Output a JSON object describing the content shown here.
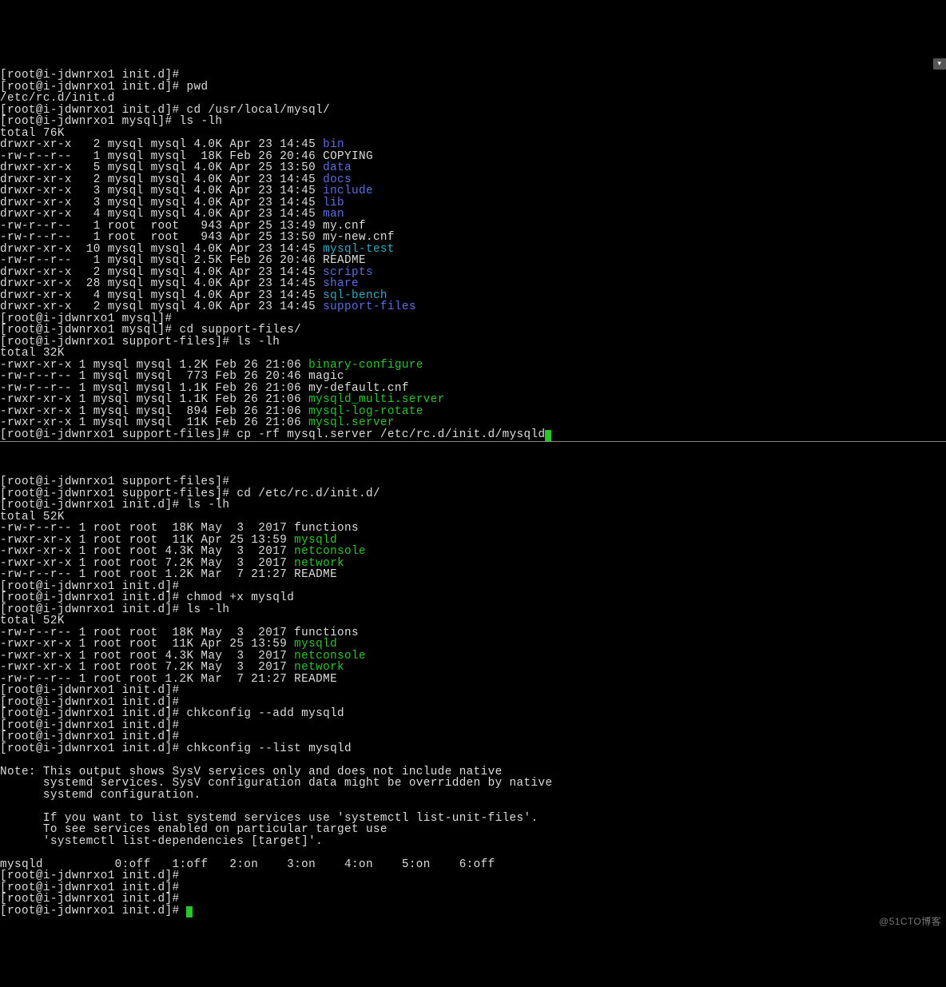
{
  "prompts": {
    "initd": "[root@i-jdwnrxo1 init.d]#",
    "mysql": "[root@i-jdwnrxo1 mysql]#",
    "support": "[root@i-jdwnrxo1 support-files]#"
  },
  "pane1": {
    "cmds": {
      "pwd": "pwd",
      "pwd_out": "/etc/rc.d/init.d",
      "cd_mysql": "cd /usr/local/mysql/",
      "ls": "ls -lh",
      "cd_support": "cd support-files/",
      "cp": "cp -rf mysql.server /etc/rc.d/init.d/mysqld"
    },
    "ls_mysql": {
      "total": "total 76K",
      "rows": [
        {
          "perm": "drwxr-xr-x",
          "ln": "  2",
          "u": "mysql",
          "g": "mysql",
          "sz": "4.0K",
          "dt": "Apr 23 14:45",
          "name": "bin",
          "cls": "b"
        },
        {
          "perm": "-rw-r--r--",
          "ln": "  1",
          "u": "mysql",
          "g": "mysql",
          "sz": " 18K",
          "dt": "Feb 26 20:46",
          "name": "COPYING",
          "cls": "w"
        },
        {
          "perm": "drwxr-xr-x",
          "ln": "  5",
          "u": "mysql",
          "g": "mysql",
          "sz": "4.0K",
          "dt": "Apr 25 13:50",
          "name": "data",
          "cls": "b"
        },
        {
          "perm": "drwxr-xr-x",
          "ln": "  2",
          "u": "mysql",
          "g": "mysql",
          "sz": "4.0K",
          "dt": "Apr 23 14:45",
          "name": "docs",
          "cls": "b"
        },
        {
          "perm": "drwxr-xr-x",
          "ln": "  3",
          "u": "mysql",
          "g": "mysql",
          "sz": "4.0K",
          "dt": "Apr 23 14:45",
          "name": "include",
          "cls": "b"
        },
        {
          "perm": "drwxr-xr-x",
          "ln": "  3",
          "u": "mysql",
          "g": "mysql",
          "sz": "4.0K",
          "dt": "Apr 23 14:45",
          "name": "lib",
          "cls": "b"
        },
        {
          "perm": "drwxr-xr-x",
          "ln": "  4",
          "u": "mysql",
          "g": "mysql",
          "sz": "4.0K",
          "dt": "Apr 23 14:45",
          "name": "man",
          "cls": "b"
        },
        {
          "perm": "-rw-r--r--",
          "ln": "  1",
          "u": "root ",
          "g": "root ",
          "sz": " 943",
          "dt": "Apr 25 13:49",
          "name": "my.cnf",
          "cls": "w"
        },
        {
          "perm": "-rw-r--r--",
          "ln": "  1",
          "u": "root ",
          "g": "root ",
          "sz": " 943",
          "dt": "Apr 25 13:50",
          "name": "my-new.cnf",
          "cls": "w"
        },
        {
          "perm": "drwxr-xr-x",
          "ln": " 10",
          "u": "mysql",
          "g": "mysql",
          "sz": "4.0K",
          "dt": "Apr 23 14:45",
          "name": "mysql-test",
          "cls": "c"
        },
        {
          "perm": "-rw-r--r--",
          "ln": "  1",
          "u": "mysql",
          "g": "mysql",
          "sz": "2.5K",
          "dt": "Feb 26 20:46",
          "name": "README",
          "cls": "w"
        },
        {
          "perm": "drwxr-xr-x",
          "ln": "  2",
          "u": "mysql",
          "g": "mysql",
          "sz": "4.0K",
          "dt": "Apr 23 14:45",
          "name": "scripts",
          "cls": "b"
        },
        {
          "perm": "drwxr-xr-x",
          "ln": " 28",
          "u": "mysql",
          "g": "mysql",
          "sz": "4.0K",
          "dt": "Apr 23 14:45",
          "name": "share",
          "cls": "b"
        },
        {
          "perm": "drwxr-xr-x",
          "ln": "  4",
          "u": "mysql",
          "g": "mysql",
          "sz": "4.0K",
          "dt": "Apr 23 14:45",
          "name": "sql-bench",
          "cls": "c"
        },
        {
          "perm": "drwxr-xr-x",
          "ln": "  2",
          "u": "mysql",
          "g": "mysql",
          "sz": "4.0K",
          "dt": "Apr 23 14:45",
          "name": "support-files",
          "cls": "b"
        }
      ]
    },
    "ls_support": {
      "total": "total 32K",
      "rows": [
        {
          "perm": "-rwxr-xr-x",
          "ln": "1",
          "u": "mysql",
          "g": "mysql",
          "sz": "1.2K",
          "dt": "Feb 26 21:06",
          "name": "binary-configure",
          "cls": "g"
        },
        {
          "perm": "-rw-r--r--",
          "ln": "1",
          "u": "mysql",
          "g": "mysql",
          "sz": " 773",
          "dt": "Feb 26 20:46",
          "name": "magic",
          "cls": "w"
        },
        {
          "perm": "-rw-r--r--",
          "ln": "1",
          "u": "mysql",
          "g": "mysql",
          "sz": "1.1K",
          "dt": "Feb 26 21:06",
          "name": "my-default.cnf",
          "cls": "w"
        },
        {
          "perm": "-rwxr-xr-x",
          "ln": "1",
          "u": "mysql",
          "g": "mysql",
          "sz": "1.1K",
          "dt": "Feb 26 21:06",
          "name": "mysqld_multi.server",
          "cls": "g"
        },
        {
          "perm": "-rwxr-xr-x",
          "ln": "1",
          "u": "mysql",
          "g": "mysql",
          "sz": " 894",
          "dt": "Feb 26 21:06",
          "name": "mysql-log-rotate",
          "cls": "g"
        },
        {
          "perm": "-rwxr-xr-x",
          "ln": "1",
          "u": "mysql",
          "g": "mysql",
          "sz": " 11K",
          "dt": "Feb 26 21:06",
          "name": "mysql.server",
          "cls": "g"
        }
      ]
    }
  },
  "pane2": {
    "cmds": {
      "cd_initd": "cd /etc/rc.d/init.d/",
      "ls": "ls -lh",
      "chmod": "chmod +x mysqld",
      "chk_add": "chkconfig --add mysqld",
      "chk_list": "chkconfig --list mysqld"
    },
    "ls_initd1": {
      "total": "total 52K",
      "rows": [
        {
          "perm": "-rw-r--r--",
          "ln": "1",
          "u": "root",
          "g": "root",
          "sz": " 18K",
          "dt": "May  3  2017",
          "name": "functions",
          "cls": "w"
        },
        {
          "perm": "-rwxr-xr-x",
          "ln": "1",
          "u": "root",
          "g": "root",
          "sz": " 11K",
          "dt": "Apr 25 13:59",
          "name": "mysqld",
          "cls": "g"
        },
        {
          "perm": "-rwxr-xr-x",
          "ln": "1",
          "u": "root",
          "g": "root",
          "sz": "4.3K",
          "dt": "May  3  2017",
          "name": "netconsole",
          "cls": "g"
        },
        {
          "perm": "-rwxr-xr-x",
          "ln": "1",
          "u": "root",
          "g": "root",
          "sz": "7.2K",
          "dt": "May  3  2017",
          "name": "network",
          "cls": "g"
        },
        {
          "perm": "-rw-r--r--",
          "ln": "1",
          "u": "root",
          "g": "root",
          "sz": "1.2K",
          "dt": "Mar  7 21:27",
          "name": "README",
          "cls": "w"
        }
      ]
    },
    "ls_initd2": {
      "total": "total 52K",
      "rows": [
        {
          "perm": "-rw-r--r--",
          "ln": "1",
          "u": "root",
          "g": "root",
          "sz": " 18K",
          "dt": "May  3  2017",
          "name": "functions",
          "cls": "w"
        },
        {
          "perm": "-rwxr-xr-x",
          "ln": "1",
          "u": "root",
          "g": "root",
          "sz": " 11K",
          "dt": "Apr 25 13:59",
          "name": "mysqld",
          "cls": "g"
        },
        {
          "perm": "-rwxr-xr-x",
          "ln": "1",
          "u": "root",
          "g": "root",
          "sz": "4.3K",
          "dt": "May  3  2017",
          "name": "netconsole",
          "cls": "g"
        },
        {
          "perm": "-rwxr-xr-x",
          "ln": "1",
          "u": "root",
          "g": "root",
          "sz": "7.2K",
          "dt": "May  3  2017",
          "name": "network",
          "cls": "g"
        },
        {
          "perm": "-rw-r--r--",
          "ln": "1",
          "u": "root",
          "g": "root",
          "sz": "1.2K",
          "dt": "Mar  7 21:27",
          "name": "README",
          "cls": "w"
        }
      ]
    },
    "note": [
      "Note: This output shows SysV services only and does not include native",
      "      systemd services. SysV configuration data might be overridden by native",
      "      systemd configuration.",
      "",
      "      If you want to list systemd services use 'systemctl list-unit-files'.",
      "      To see services enabled on particular target use",
      "      'systemctl list-dependencies [target]'."
    ],
    "runlevels": "mysqld          0:off   1:off   2:on    3:on    4:on    5:on    6:off"
  },
  "watermark": "@51CTO博客"
}
